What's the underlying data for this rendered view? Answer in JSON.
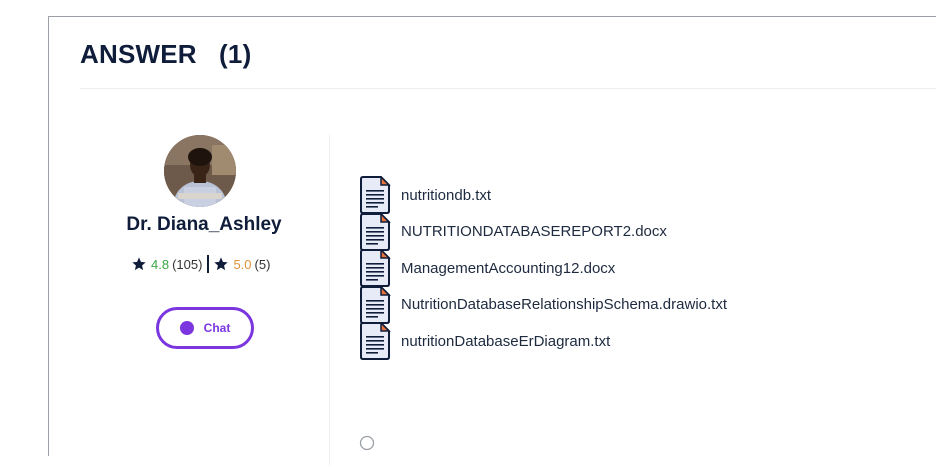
{
  "header": {
    "title": "ANSWER",
    "count": "(1)"
  },
  "expert": {
    "name": "Dr. Diana_Ashley",
    "rating_primary": "4.8",
    "reviews_primary": "(105)",
    "rating_secondary": "5.0",
    "reviews_secondary": "(5)",
    "chat_label": "Chat"
  },
  "attachments": [
    {
      "name": "nutritiondb.txt"
    },
    {
      "name": "NUTRITIONDATABASEREPORT2.docx"
    },
    {
      "name": "ManagementAccounting12.docx"
    },
    {
      "name": "NutritionDatabaseRelationshipSchema.drawio.txt"
    },
    {
      "name": "nutritionDatabaseErDiagram.txt"
    }
  ],
  "colors": {
    "accent": "#7b36e0",
    "heading": "#0f1d3a",
    "rating_green": "#3aa745",
    "rating_orange": "#e0913a",
    "file_icon_fill": "#e6ebf7",
    "file_icon_corner": "#e8743b"
  },
  "icons": {
    "star": "star-icon",
    "file": "document-icon",
    "chat": "chat-dot-icon"
  }
}
